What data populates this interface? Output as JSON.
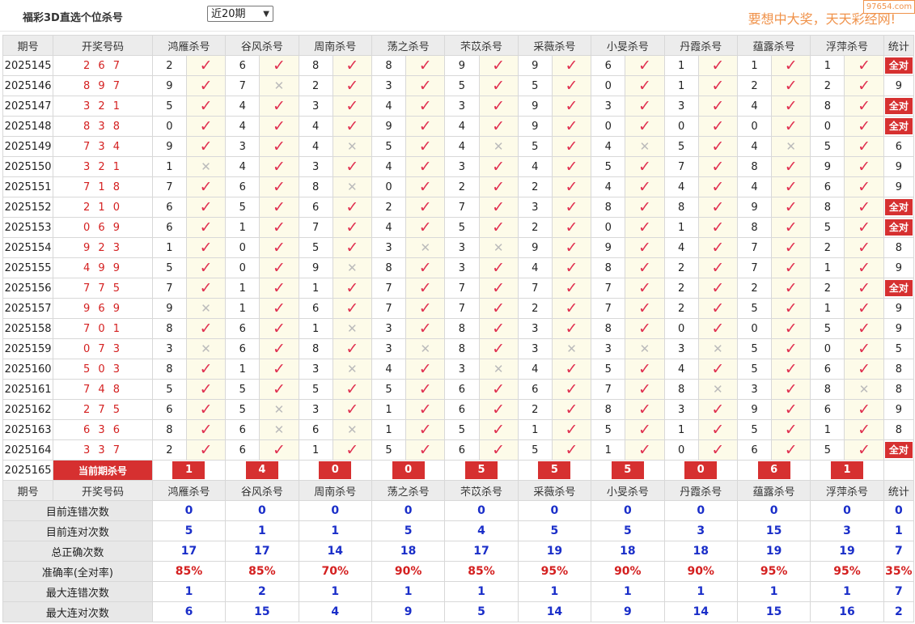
{
  "header": {
    "title": "福彩3D直选个位杀号",
    "select_value": "近20期",
    "slogan": "要想中大奖，天天彩经网!",
    "watermark": "97654.com"
  },
  "columns": [
    "期号",
    "开奖号码",
    "鸿雁杀号",
    "谷风杀号",
    "周南杀号",
    "荡之杀号",
    "芣苡杀号",
    "采薇杀号",
    "小旻杀号",
    "丹霞杀号",
    "蕴露杀号",
    "浮萍杀号",
    "统计"
  ],
  "all_right_label": "全对",
  "rows": [
    {
      "period": "2025145",
      "draw": "267",
      "picks": [
        [
          2,
          1
        ],
        [
          6,
          1
        ],
        [
          8,
          1
        ],
        [
          8,
          1
        ],
        [
          9,
          1
        ],
        [
          9,
          1
        ],
        [
          6,
          1
        ],
        [
          1,
          1
        ],
        [
          1,
          1
        ],
        [
          1,
          1
        ]
      ],
      "stat": "全对"
    },
    {
      "period": "2025146",
      "draw": "897",
      "picks": [
        [
          9,
          1
        ],
        [
          7,
          0
        ],
        [
          2,
          1
        ],
        [
          3,
          1
        ],
        [
          5,
          1
        ],
        [
          5,
          1
        ],
        [
          0,
          1
        ],
        [
          1,
          1
        ],
        [
          2,
          1
        ],
        [
          2,
          1
        ]
      ],
      "stat": "9"
    },
    {
      "period": "2025147",
      "draw": "321",
      "picks": [
        [
          5,
          1
        ],
        [
          4,
          1
        ],
        [
          3,
          1
        ],
        [
          4,
          1
        ],
        [
          3,
          1
        ],
        [
          9,
          1
        ],
        [
          3,
          1
        ],
        [
          3,
          1
        ],
        [
          4,
          1
        ],
        [
          8,
          1
        ]
      ],
      "stat": "全对"
    },
    {
      "period": "2025148",
      "draw": "838",
      "picks": [
        [
          0,
          1
        ],
        [
          4,
          1
        ],
        [
          4,
          1
        ],
        [
          9,
          1
        ],
        [
          4,
          1
        ],
        [
          9,
          1
        ],
        [
          0,
          1
        ],
        [
          0,
          1
        ],
        [
          0,
          1
        ],
        [
          0,
          1
        ]
      ],
      "stat": "全对"
    },
    {
      "period": "2025149",
      "draw": "734",
      "picks": [
        [
          9,
          1
        ],
        [
          3,
          1
        ],
        [
          4,
          0
        ],
        [
          5,
          1
        ],
        [
          4,
          0
        ],
        [
          5,
          1
        ],
        [
          4,
          0
        ],
        [
          5,
          1
        ],
        [
          4,
          0
        ],
        [
          5,
          1
        ]
      ],
      "stat": "6"
    },
    {
      "period": "2025150",
      "draw": "321",
      "picks": [
        [
          1,
          0
        ],
        [
          4,
          1
        ],
        [
          3,
          1
        ],
        [
          4,
          1
        ],
        [
          3,
          1
        ],
        [
          4,
          1
        ],
        [
          5,
          1
        ],
        [
          7,
          1
        ],
        [
          8,
          1
        ],
        [
          9,
          1
        ]
      ],
      "stat": "9"
    },
    {
      "period": "2025151",
      "draw": "718",
      "picks": [
        [
          7,
          1
        ],
        [
          6,
          1
        ],
        [
          8,
          0
        ],
        [
          0,
          1
        ],
        [
          2,
          1
        ],
        [
          2,
          1
        ],
        [
          4,
          1
        ],
        [
          4,
          1
        ],
        [
          4,
          1
        ],
        [
          6,
          1
        ]
      ],
      "stat": "9"
    },
    {
      "period": "2025152",
      "draw": "210",
      "picks": [
        [
          6,
          1
        ],
        [
          5,
          1
        ],
        [
          6,
          1
        ],
        [
          2,
          1
        ],
        [
          7,
          1
        ],
        [
          3,
          1
        ],
        [
          8,
          1
        ],
        [
          8,
          1
        ],
        [
          9,
          1
        ],
        [
          8,
          1
        ]
      ],
      "stat": "全对"
    },
    {
      "period": "2025153",
      "draw": "069",
      "picks": [
        [
          6,
          1
        ],
        [
          1,
          1
        ],
        [
          7,
          1
        ],
        [
          4,
          1
        ],
        [
          5,
          1
        ],
        [
          2,
          1
        ],
        [
          0,
          1
        ],
        [
          1,
          1
        ],
        [
          8,
          1
        ],
        [
          5,
          1
        ]
      ],
      "stat": "全对"
    },
    {
      "period": "2025154",
      "draw": "923",
      "picks": [
        [
          1,
          1
        ],
        [
          0,
          1
        ],
        [
          5,
          1
        ],
        [
          3,
          0
        ],
        [
          3,
          0
        ],
        [
          9,
          1
        ],
        [
          9,
          1
        ],
        [
          4,
          1
        ],
        [
          7,
          1
        ],
        [
          2,
          1
        ]
      ],
      "stat": "8"
    },
    {
      "period": "2025155",
      "draw": "499",
      "picks": [
        [
          5,
          1
        ],
        [
          0,
          1
        ],
        [
          9,
          0
        ],
        [
          8,
          1
        ],
        [
          3,
          1
        ],
        [
          4,
          1
        ],
        [
          8,
          1
        ],
        [
          2,
          1
        ],
        [
          7,
          1
        ],
        [
          1,
          1
        ]
      ],
      "stat": "9"
    },
    {
      "period": "2025156",
      "draw": "775",
      "picks": [
        [
          7,
          1
        ],
        [
          1,
          1
        ],
        [
          1,
          1
        ],
        [
          7,
          1
        ],
        [
          7,
          1
        ],
        [
          7,
          1
        ],
        [
          7,
          1
        ],
        [
          2,
          1
        ],
        [
          2,
          1
        ],
        [
          2,
          1
        ]
      ],
      "stat": "全对"
    },
    {
      "period": "2025157",
      "draw": "969",
      "picks": [
        [
          9,
          0
        ],
        [
          1,
          1
        ],
        [
          6,
          1
        ],
        [
          7,
          1
        ],
        [
          7,
          1
        ],
        [
          2,
          1
        ],
        [
          7,
          1
        ],
        [
          2,
          1
        ],
        [
          5,
          1
        ],
        [
          1,
          1
        ]
      ],
      "stat": "9"
    },
    {
      "period": "2025158",
      "draw": "701",
      "picks": [
        [
          8,
          1
        ],
        [
          6,
          1
        ],
        [
          1,
          0
        ],
        [
          3,
          1
        ],
        [
          8,
          1
        ],
        [
          3,
          1
        ],
        [
          8,
          1
        ],
        [
          0,
          1
        ],
        [
          0,
          1
        ],
        [
          5,
          1
        ]
      ],
      "stat": "9"
    },
    {
      "period": "2025159",
      "draw": "073",
      "picks": [
        [
          3,
          0
        ],
        [
          6,
          1
        ],
        [
          8,
          1
        ],
        [
          3,
          0
        ],
        [
          8,
          1
        ],
        [
          3,
          0
        ],
        [
          3,
          0
        ],
        [
          3,
          0
        ],
        [
          5,
          1
        ],
        [
          0,
          1
        ]
      ],
      "stat": "5"
    },
    {
      "period": "2025160",
      "draw": "503",
      "picks": [
        [
          8,
          1
        ],
        [
          1,
          1
        ],
        [
          3,
          0
        ],
        [
          4,
          1
        ],
        [
          3,
          0
        ],
        [
          4,
          1
        ],
        [
          5,
          1
        ],
        [
          4,
          1
        ],
        [
          5,
          1
        ],
        [
          6,
          1
        ]
      ],
      "stat": "8"
    },
    {
      "period": "2025161",
      "draw": "748",
      "picks": [
        [
          5,
          1
        ],
        [
          5,
          1
        ],
        [
          5,
          1
        ],
        [
          5,
          1
        ],
        [
          6,
          1
        ],
        [
          6,
          1
        ],
        [
          7,
          1
        ],
        [
          8,
          0
        ],
        [
          3,
          1
        ],
        [
          8,
          0
        ]
      ],
      "stat": "8"
    },
    {
      "period": "2025162",
      "draw": "275",
      "picks": [
        [
          6,
          1
        ],
        [
          5,
          0
        ],
        [
          3,
          1
        ],
        [
          1,
          1
        ],
        [
          6,
          1
        ],
        [
          2,
          1
        ],
        [
          8,
          1
        ],
        [
          3,
          1
        ],
        [
          9,
          1
        ],
        [
          6,
          1
        ]
      ],
      "stat": "9"
    },
    {
      "period": "2025163",
      "draw": "636",
      "picks": [
        [
          8,
          1
        ],
        [
          6,
          0
        ],
        [
          6,
          0
        ],
        [
          1,
          1
        ],
        [
          5,
          1
        ],
        [
          1,
          1
        ],
        [
          5,
          1
        ],
        [
          1,
          1
        ],
        [
          5,
          1
        ],
        [
          1,
          1
        ]
      ],
      "stat": "8"
    },
    {
      "period": "2025164",
      "draw": "337",
      "picks": [
        [
          2,
          1
        ],
        [
          6,
          1
        ],
        [
          1,
          1
        ],
        [
          5,
          1
        ],
        [
          6,
          1
        ],
        [
          5,
          1
        ],
        [
          1,
          1
        ],
        [
          0,
          1
        ],
        [
          6,
          1
        ],
        [
          5,
          1
        ]
      ],
      "stat": "全对"
    }
  ],
  "current": {
    "period": "2025165",
    "label": "当前期杀号",
    "picks": [
      "1",
      "4",
      "0",
      "0",
      "5",
      "5",
      "5",
      "0",
      "6",
      "1"
    ]
  },
  "summary": [
    {
      "label": "目前连错次数",
      "values": [
        "0",
        "0",
        "0",
        "0",
        "0",
        "0",
        "0",
        "0",
        "0",
        "0",
        "0"
      ],
      "red": false
    },
    {
      "label": "目前连对次数",
      "values": [
        "5",
        "1",
        "1",
        "5",
        "4",
        "5",
        "5",
        "3",
        "15",
        "3",
        "1"
      ],
      "red": false
    },
    {
      "label": "总正确次数",
      "values": [
        "17",
        "17",
        "14",
        "18",
        "17",
        "19",
        "18",
        "18",
        "19",
        "19",
        "7"
      ],
      "red": false
    },
    {
      "label": "准确率(全对率)",
      "values": [
        "85%",
        "85%",
        "70%",
        "90%",
        "85%",
        "95%",
        "90%",
        "90%",
        "95%",
        "95%",
        "35%"
      ],
      "red": true
    },
    {
      "label": "最大连错次数",
      "values": [
        "1",
        "2",
        "1",
        "1",
        "1",
        "1",
        "1",
        "1",
        "1",
        "1",
        "7"
      ],
      "red": false
    },
    {
      "label": "最大连对次数",
      "values": [
        "6",
        "15",
        "4",
        "9",
        "5",
        "14",
        "9",
        "14",
        "15",
        "16",
        "2"
      ],
      "red": false
    }
  ]
}
